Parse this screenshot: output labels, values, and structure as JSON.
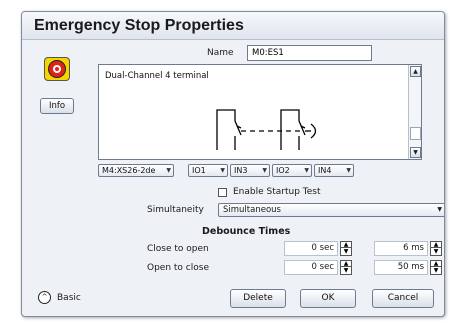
{
  "dialog": {
    "title": "Emergency Stop Properties"
  },
  "name": {
    "label": "Name",
    "value": "M0:ES1"
  },
  "info_button": "Info",
  "description": {
    "text": "Dual-Channel 4 terminal"
  },
  "terminals": [
    {
      "label": "M4:XS26-2de"
    },
    {
      "label": "IO1"
    },
    {
      "label": "IN3"
    },
    {
      "label": "IO2"
    },
    {
      "label": "IN4"
    }
  ],
  "startup_test": {
    "label": "Enable Startup Test",
    "checked": false
  },
  "simultaneity": {
    "label": "Simultaneity",
    "value": "Simultaneous"
  },
  "debounce": {
    "title": "Debounce Times",
    "rows": [
      {
        "label": "Close to open",
        "value1": "0 sec",
        "value2": "6 ms"
      },
      {
        "label": "Open to close",
        "value1": "0 sec",
        "value2": "50 ms"
      }
    ]
  },
  "buttons": {
    "basic": "Basic",
    "delete": "Delete",
    "ok": "OK",
    "cancel": "Cancel"
  },
  "icons": {
    "estop": "emergency-stop-icon",
    "basic": "chevron-up-icon",
    "spinner": "up-down-arrow-icon"
  },
  "colors": {
    "estop_ring": "#e02318",
    "estop_base": "#f5d400",
    "dialog_bg": "#eef1f6"
  }
}
